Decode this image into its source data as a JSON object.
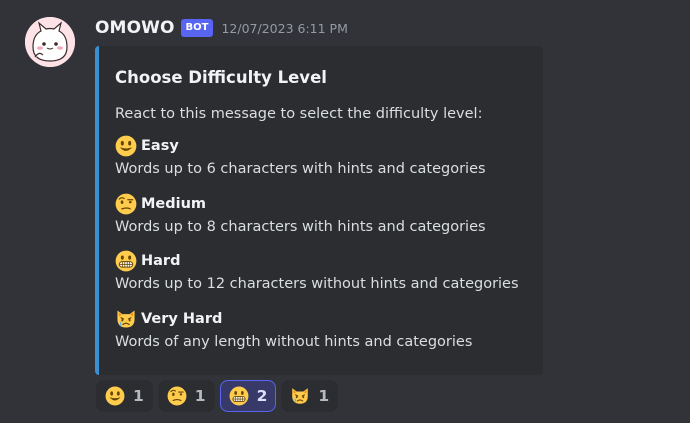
{
  "message": {
    "author": "OMOWO",
    "bot_tag": "BOT",
    "timestamp": "12/07/2023 6:11 PM"
  },
  "embed": {
    "accent_color": "#3c8fd1",
    "title": "Choose Difficulty Level",
    "description": "React to this message to select the difficulty level:",
    "levels": [
      {
        "icon": "smiley-face-icon",
        "name": "Easy",
        "description": "Words up to 6 characters with hints and categories"
      },
      {
        "icon": "raised-eyebrow-face-icon",
        "name": "Medium",
        "description": "Words up to 8 characters with hints and categories"
      },
      {
        "icon": "grimacing-face-icon",
        "name": "Hard",
        "description": "Words up to 12 characters without hints and categories"
      },
      {
        "icon": "crying-cat-face-icon",
        "name": "Very Hard",
        "description": "Words of any length without hints and categories"
      }
    ]
  },
  "reactions": [
    {
      "icon": "smiley-face-icon",
      "count": "1",
      "active": false
    },
    {
      "icon": "raised-eyebrow-face-icon",
      "count": "1",
      "active": false
    },
    {
      "icon": "grimacing-face-icon",
      "count": "2",
      "active": true
    },
    {
      "icon": "crying-cat-face-icon",
      "count": "1",
      "active": false
    }
  ],
  "colors": {
    "background": "#313338",
    "embed_background": "#2b2d31",
    "bot_tag": "#5865f2",
    "active_reaction_border": "#5865f2"
  }
}
